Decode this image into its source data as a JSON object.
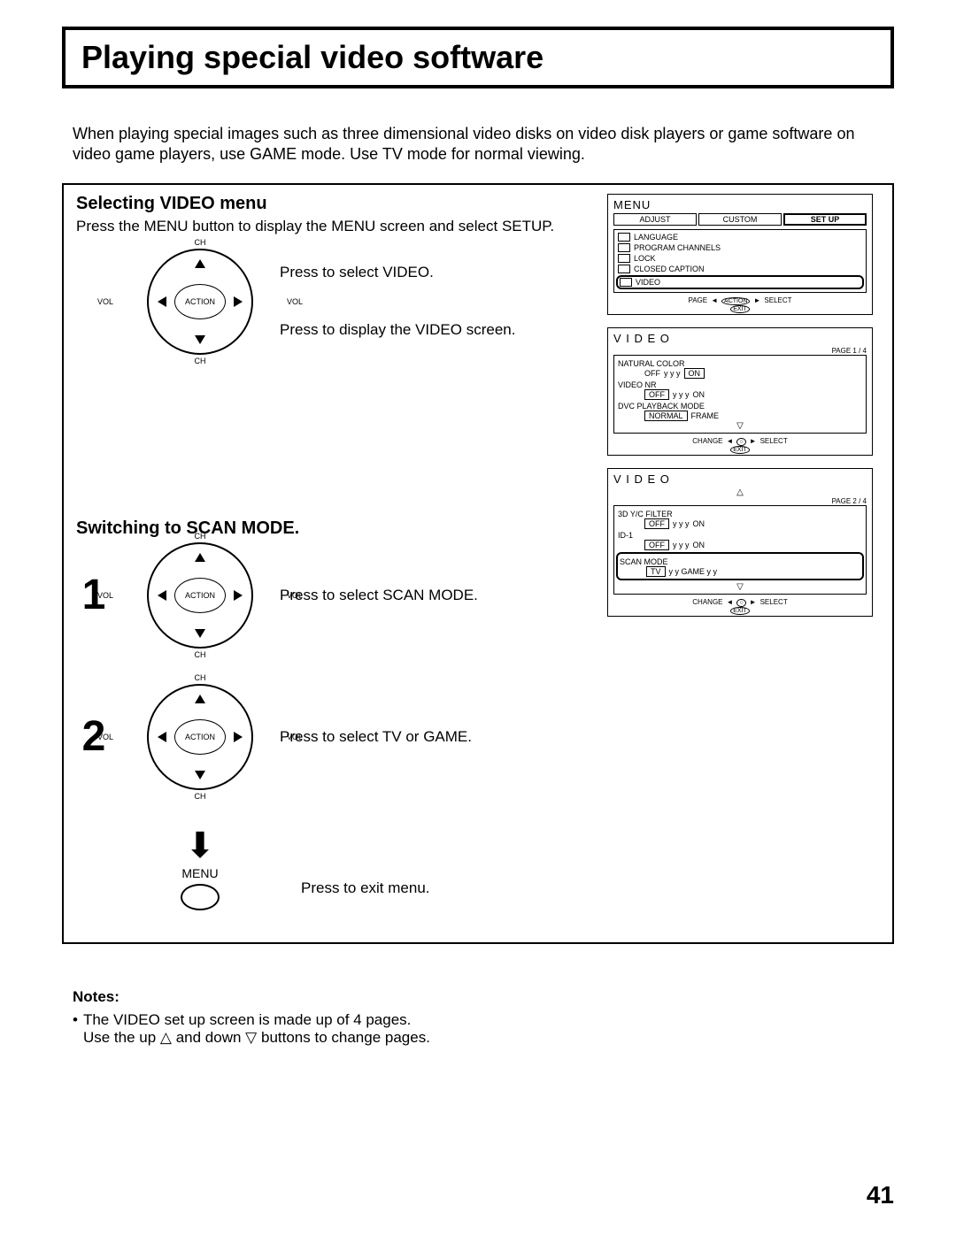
{
  "title": "Playing special video software",
  "intro": "When playing special images such as three dimensional video disks on video disk players or game software on video game players, use GAME mode. Use TV mode for normal viewing.",
  "section1": {
    "heading": "Selecting VIDEO menu",
    "text": "Press the MENU button to display the MENU screen and select SETUP.",
    "cap1": "Press to select VIDEO.",
    "cap2": "Press to display the VIDEO screen."
  },
  "section2": {
    "heading": "Switching to SCAN MODE.",
    "step1": "1",
    "cap1": "Press to select SCAN MODE.",
    "step2": "2",
    "cap2": "Press to select TV or GAME.",
    "menu_label": "MENU",
    "cap3": "Press to exit menu."
  },
  "dial": {
    "ch": "CH",
    "vol": "VOL",
    "action": "ACTION"
  },
  "osd_menu": {
    "title": "MENU",
    "tabs": [
      "ADJUST",
      "CUSTOM",
      "SET UP"
    ],
    "items": [
      "LANGUAGE",
      "PROGRAM CHANNELS",
      "LOCK",
      "CLOSED CAPTION",
      "VIDEO"
    ],
    "foot_page": "PAGE",
    "foot_action": "ACTION",
    "foot_select": "SELECT",
    "foot_exit": "EXIT"
  },
  "osd_video1": {
    "title": "V I D E O",
    "page": "PAGE 1 / 4",
    "items": [
      {
        "label": "NATURAL COLOR",
        "opts": [
          "OFF",
          "y y y",
          "ON"
        ],
        "sel": 2
      },
      {
        "label": "VIDEO NR",
        "opts": [
          "OFF",
          "y y y",
          "ON"
        ],
        "sel": 0
      },
      {
        "label": "DVC PLAYBACK MODE",
        "opts": [
          "NORMAL",
          "FRAME"
        ],
        "sel": 0
      }
    ],
    "foot_change": "CHANGE",
    "foot_select": "SELECT",
    "foot_exit": "EXIT"
  },
  "osd_video2": {
    "title": "V I D E O",
    "page": "PAGE 2 / 4",
    "items": [
      {
        "label": "3D Y/C FILTER",
        "opts": [
          "OFF",
          "y y y",
          "ON"
        ],
        "sel": 0
      },
      {
        "label": "ID-1",
        "opts": [
          "OFF",
          "y y y",
          "ON"
        ],
        "sel": 0
      },
      {
        "label": "SCAN MODE",
        "opts": [
          "TV",
          "y y GAME y y"
        ],
        "sel": 0,
        "hl": true
      }
    ],
    "foot_change": "CHANGE",
    "foot_select": "SELECT",
    "foot_exit": "EXIT"
  },
  "notes": {
    "heading": "Notes:",
    "bullet": "•",
    "line1": "The VIDEO set up screen is made up of 4 pages.",
    "line2a": "Use the up ",
    "line2b": " and down ",
    "line2c": " buttons to change pages."
  },
  "page_number": "41"
}
